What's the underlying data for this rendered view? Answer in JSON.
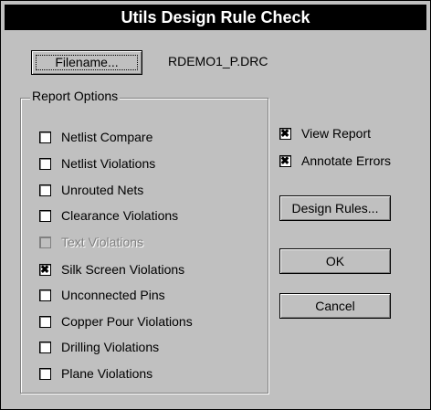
{
  "window": {
    "title": "Utils Design Rule Check"
  },
  "file": {
    "button_label": "Filename...",
    "value": "RDEMO1_P.DRC"
  },
  "report_options": {
    "title": "Report Options",
    "items": [
      {
        "label": "Netlist Compare",
        "checked": false,
        "disabled": false
      },
      {
        "label": "Netlist Violations",
        "checked": false,
        "disabled": false
      },
      {
        "label": "Unrouted Nets",
        "checked": false,
        "disabled": false
      },
      {
        "label": "Clearance Violations",
        "checked": false,
        "disabled": false
      },
      {
        "label": "Text Violations",
        "checked": false,
        "disabled": true
      },
      {
        "label": "Silk Screen Violations",
        "checked": true,
        "disabled": false
      },
      {
        "label": "Unconnected Pins",
        "checked": false,
        "disabled": false
      },
      {
        "label": "Copper Pour Violations",
        "checked": false,
        "disabled": false
      },
      {
        "label": "Drilling Violations",
        "checked": false,
        "disabled": false
      },
      {
        "label": "Plane Violations",
        "checked": false,
        "disabled": false
      }
    ]
  },
  "options": {
    "view_report": {
      "label": "View Report",
      "checked": true
    },
    "annotate_errors": {
      "label": "Annotate Errors",
      "checked": true
    }
  },
  "buttons": {
    "design_rules": "Design Rules...",
    "ok": "OK",
    "cancel": "Cancel"
  }
}
